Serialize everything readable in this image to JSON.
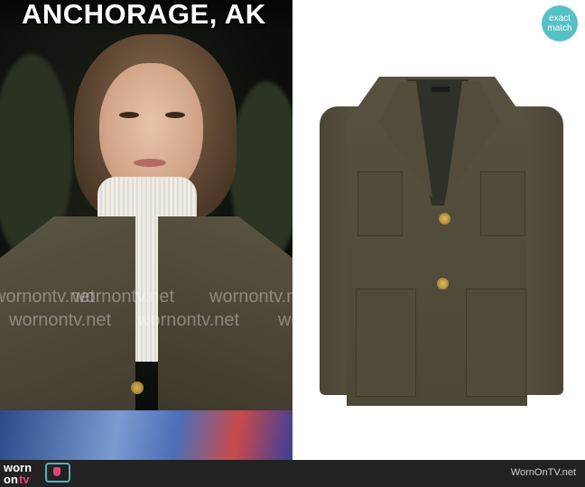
{
  "caption": "ANCHORAGE, AK",
  "badge": {
    "line1": "exact",
    "line2": "match",
    "color": "#55c1c6"
  },
  "watermark": {
    "text": "wornontv.net"
  },
  "footer": {
    "logo_worn": "worn",
    "logo_on": "on",
    "logo_tv": "tv",
    "logo_icon": "tv-icon",
    "url": "WornOnTV.net"
  },
  "colors": {
    "jacket": "#57513f",
    "footer_bg": "#222222",
    "logo_pink": "#e8417c",
    "logo_teal": "#49b6c1"
  }
}
